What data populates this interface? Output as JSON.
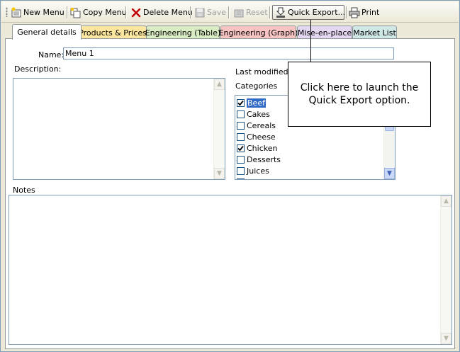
{
  "toolbar": {
    "new_menu": "New Menu",
    "copy_menu": "Copy Menu",
    "delete_menu": "Delete Menu",
    "save": "Save",
    "reset": "Reset",
    "quick_export": "Quick Export...",
    "print": "Print"
  },
  "tabs": [
    {
      "label": "General details",
      "color": "#ffffff"
    },
    {
      "label": "Products & Prices",
      "color": "#fde7a0"
    },
    {
      "label": "Engineering (Table)",
      "color": "#d9ecc4"
    },
    {
      "label": "Engineering (Graph)",
      "color": "#f7c3c3"
    },
    {
      "label": "Mise-en-place",
      "color": "#e4d7f2"
    },
    {
      "label": "Market List",
      "color": "#cfe8e6"
    }
  ],
  "form": {
    "name_label": "Name:",
    "name_value": "Menu 1",
    "description_label": "Description:",
    "last_modified_label": "Last modified:",
    "categories_label": "Categories",
    "notes_label": "Notes"
  },
  "categories": [
    {
      "label": "Beef",
      "checked": true,
      "selected": true
    },
    {
      "label": "Cakes",
      "checked": false,
      "selected": false
    },
    {
      "label": "Cereals",
      "checked": false,
      "selected": false
    },
    {
      "label": "Cheese",
      "checked": false,
      "selected": false
    },
    {
      "label": "Chicken",
      "checked": true,
      "selected": false
    },
    {
      "label": "Desserts",
      "checked": false,
      "selected": false
    },
    {
      "label": "Juices",
      "checked": false,
      "selected": false
    }
  ],
  "callout": {
    "line1": "Click here to launch the",
    "line2": "Quick Export option."
  },
  "colors": {
    "selection": "#316ac5",
    "border": "#7f9db9",
    "window_bg": "#ece9d8"
  }
}
